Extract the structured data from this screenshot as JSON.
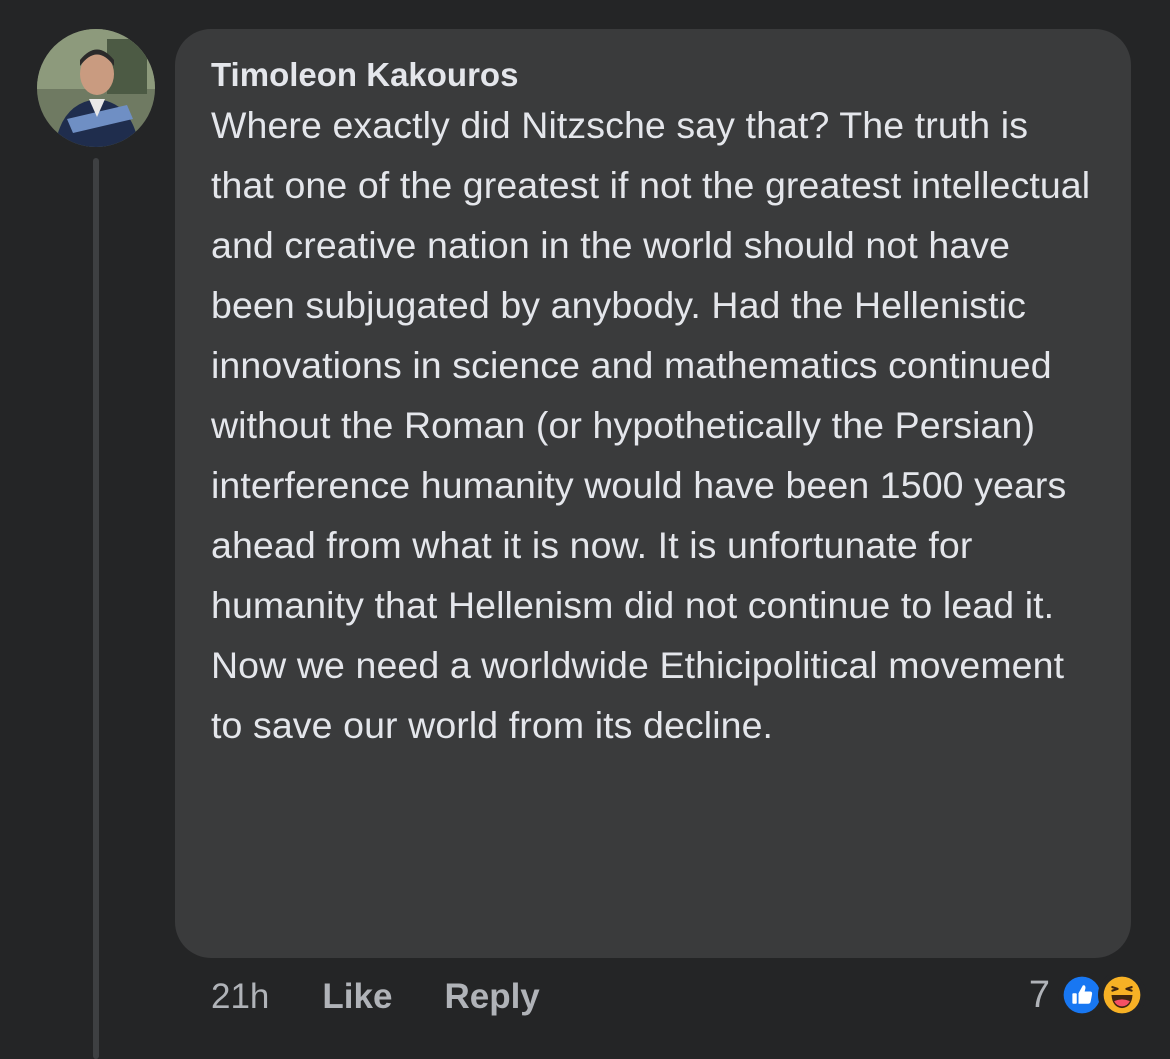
{
  "comment": {
    "author": "Timoleon Kakouros",
    "text": "Where exactly did Nitzsche say that? The truth is that one of the greatest if not the greatest intellectual and creative nation in the world should not have been subjugated by anybody. Had the Hellenistic innovations in science and mathematics continued without the Roman (or hypothetically the Persian) interference humanity would have been 1500 years ahead from what it is now. It is unfortunate for humanity that Hellenism did not continue to lead it. Now we need a worldwide Ethicipolitical movement to save our world from its decline.",
    "timestamp": "21h",
    "like_label": "Like",
    "reply_label": "Reply",
    "reaction_count": "7",
    "reactions": [
      "like-icon",
      "haha-icon"
    ]
  },
  "colors": {
    "background": "#242526",
    "bubble": "#3a3b3c",
    "text_primary": "#e4e6eb",
    "text_secondary": "#b0b3b8",
    "like_blue": "#1877f2",
    "haha_yellow": "#f7b125"
  }
}
